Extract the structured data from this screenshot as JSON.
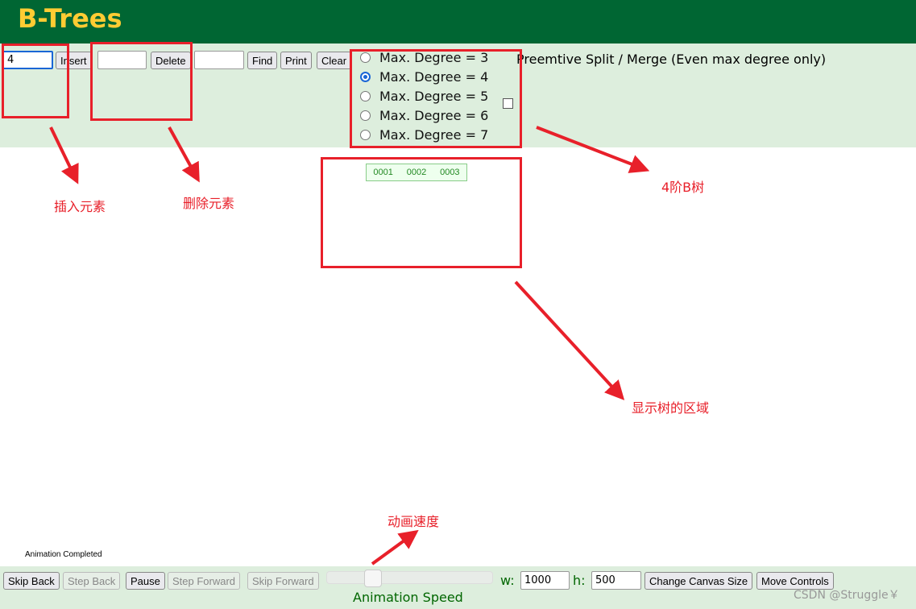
{
  "header": {
    "title": "B-Trees"
  },
  "controls": {
    "insert_value": "4",
    "insert_label": "Insert",
    "delete_value": "",
    "delete_label": "Delete",
    "find_value": "",
    "find_label": "Find",
    "print_label": "Print",
    "clear_label": "Clear",
    "degrees": [
      {
        "label": "Max. Degree = 3",
        "checked": false
      },
      {
        "label": "Max. Degree = 4",
        "checked": true
      },
      {
        "label": "Max. Degree = 5",
        "checked": false
      },
      {
        "label": "Max. Degree = 6",
        "checked": false
      },
      {
        "label": "Max. Degree = 7",
        "checked": false
      }
    ],
    "preemptive_label": "Preemtive Split / Merge (Even max degree only)",
    "preemptive_checked": false
  },
  "tree": {
    "keys": [
      "0001",
      "0002",
      "0003"
    ]
  },
  "status": "Animation Completed",
  "playback": {
    "skip_back": "Skip Back",
    "step_back": "Step Back",
    "pause": "Pause",
    "step_forward": "Step Forward",
    "skip_forward": "Skip Forward",
    "speed_label": "Animation Speed",
    "speed_fraction": 0.25,
    "w_label": "w:",
    "w_value": "1000",
    "h_label": "h:",
    "h_value": "500",
    "change_size": "Change Canvas Size",
    "move_controls": "Move Controls"
  },
  "annotations": {
    "insert": "插入元素",
    "delete": "删除元素",
    "degree": "4阶B树",
    "area": "显示树的区域",
    "speed": "动画速度",
    "color": "#e8202a"
  },
  "watermark": "CSDN @Struggle￥"
}
